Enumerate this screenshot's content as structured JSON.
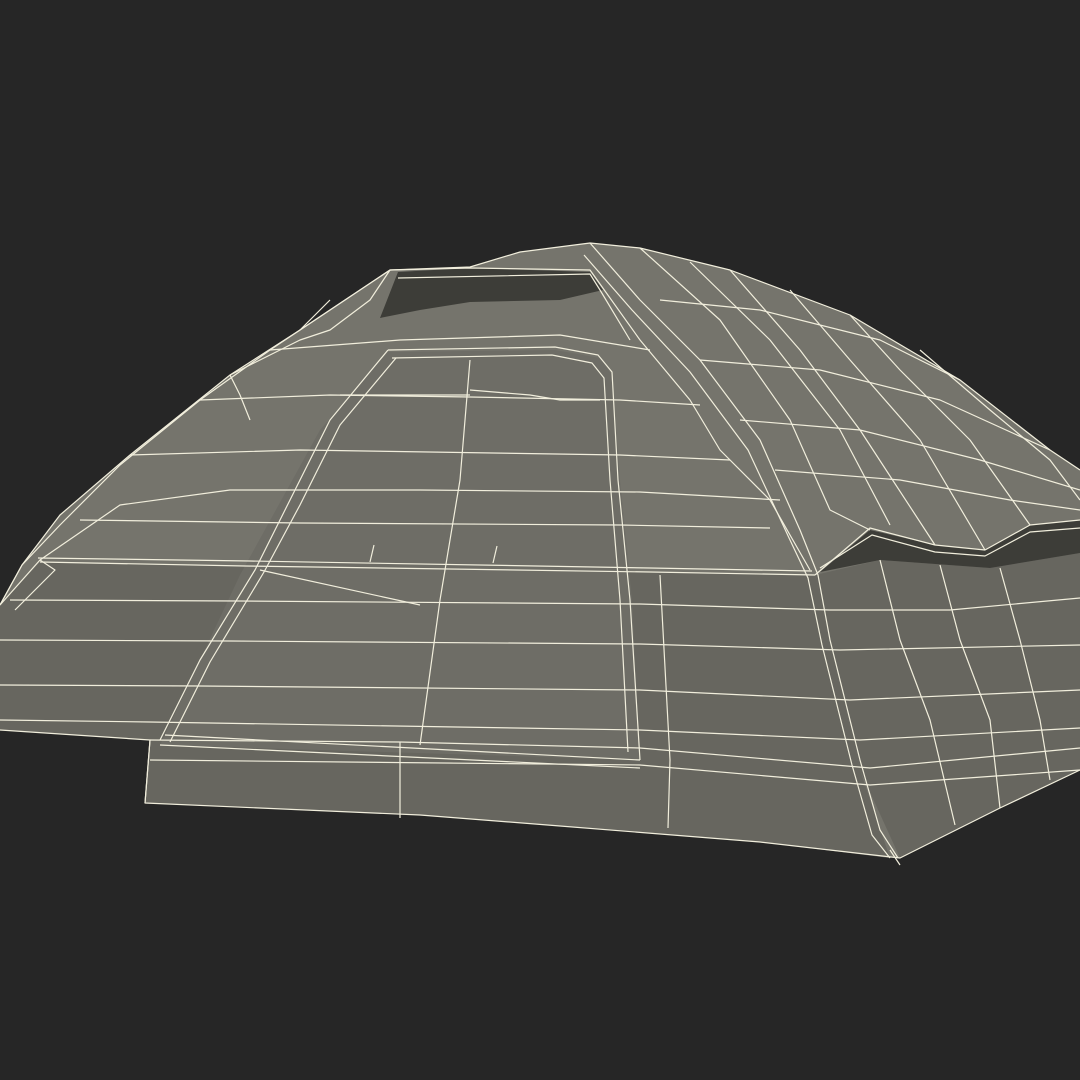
{
  "scene": {
    "subject": "tent-wireframe-render",
    "colors": {
      "background": "#262626",
      "surface": "#75746c",
      "surface_shadow": "#67665f",
      "surface_dark": "#55554f",
      "interior": "#3d3d38",
      "wire": "#f1eedc"
    }
  }
}
